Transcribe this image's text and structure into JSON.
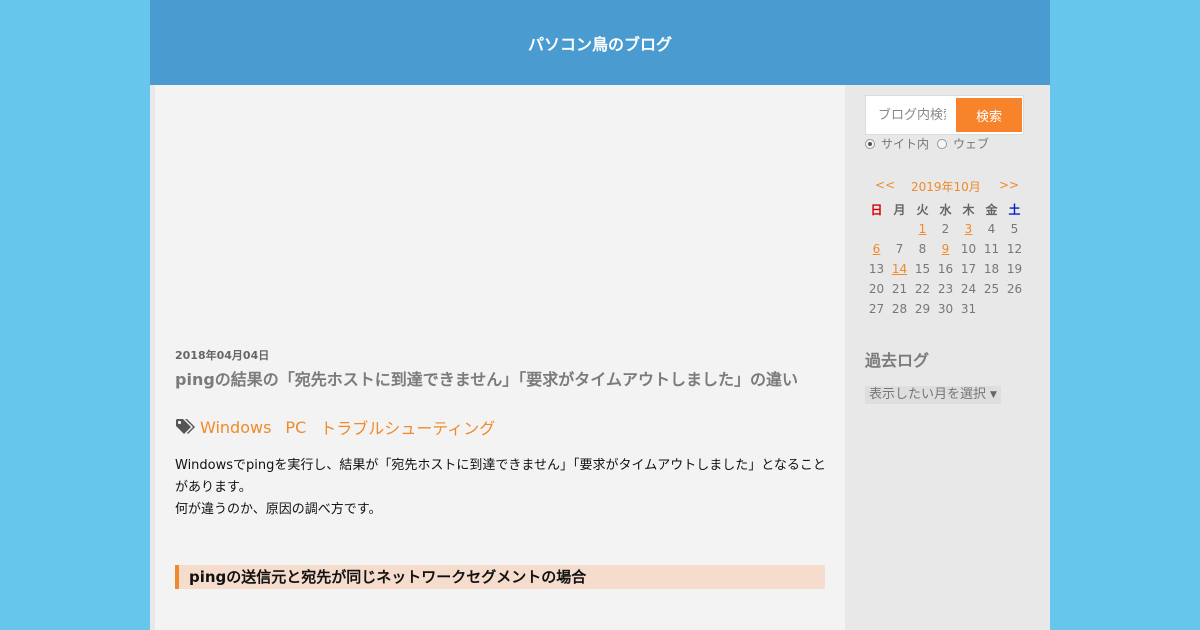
{
  "header": {
    "site_title": "パソコン鳥のブログ"
  },
  "post": {
    "date": "2018年04月04日",
    "title": "pingの結果の「宛先ホストに到達できません」「要求がタイムアウトしました」の違い",
    "tags": [
      "Windows",
      "PC",
      "トラブルシューティング"
    ],
    "intro": [
      "Windowsでpingを実行し、結果が「宛先ホストに到達できません」「要求がタイムアウトしました」となること",
      "があります。",
      "何が違うのか、原因の調べ方です。"
    ],
    "section_heading": "pingの送信元と宛先が同じネットワークセグメントの場合"
  },
  "sidebar": {
    "search": {
      "placeholder": "ブログ内検索",
      "button_label": "検索",
      "scope_site": "サイト内",
      "scope_web": "ウェブ",
      "selected_scope": "site"
    },
    "calendar": {
      "prev": "<<",
      "month": "2019年10月",
      "next": ">>",
      "weekdays": [
        "日",
        "月",
        "火",
        "水",
        "木",
        "金",
        "土"
      ],
      "weeks": [
        [
          "",
          "",
          "1",
          "2",
          "3",
          "4",
          "5"
        ],
        [
          "6",
          "7",
          "8",
          "9",
          "10",
          "11",
          "12"
        ],
        [
          "13",
          "14",
          "15",
          "16",
          "17",
          "18",
          "19"
        ],
        [
          "20",
          "21",
          "22",
          "23",
          "24",
          "25",
          "26"
        ],
        [
          "27",
          "28",
          "29",
          "30",
          "31",
          "",
          ""
        ]
      ],
      "linked_days": [
        "1",
        "3",
        "6",
        "9",
        "14"
      ]
    },
    "archive": {
      "heading": "過去ログ",
      "select_label": "表示したい月を選択"
    }
  },
  "colors": {
    "background": "#67c6ec",
    "header": "#4a9bd0",
    "accent": "#f08a2a",
    "search_button": "#f7832b",
    "section_heading_bg": "#f6dccd"
  }
}
